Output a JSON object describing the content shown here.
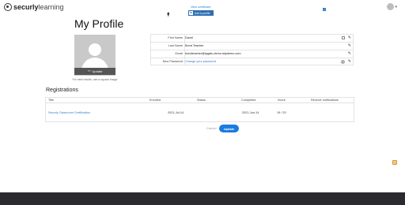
{
  "header": {
    "logo_bold": "securly",
    "logo_light": "learning",
    "account_caret": "▾"
  },
  "page": {
    "title": "My Profile"
  },
  "photo": {
    "update_label": "Update",
    "camera_icon": "📷",
    "hint": "For best results, use a square image"
  },
  "profile_fields": [
    {
      "label": "First Name",
      "value": "David"
    },
    {
      "label": "Last Name",
      "value": "Bond Teacher"
    },
    {
      "label": "Email",
      "value": "bondteacher@ipgatu.demo.lalpdemo.com"
    },
    {
      "label": "New Password",
      "value": "Change your password"
    }
  ],
  "registrations": {
    "title": "Registrations",
    "columns": [
      "Title",
      "Enrolled",
      "Status",
      "Completed",
      "Score",
      "Receive notifications"
    ],
    "rows": [
      {
        "title": "Securly Classroom Certification",
        "enrolled": "2021-Jul-14",
        "status_link": "View certificate",
        "linkedin_label": "Add to profile",
        "completed": "2021-Jun-14",
        "score": "19 / 20",
        "notifications": true
      }
    ]
  },
  "actions": {
    "cancel_label": "Cancel",
    "update_label": "Update"
  },
  "icons": {
    "edit": "✎",
    "linkedin": "in",
    "check": "✓",
    "info": "i"
  },
  "colors": {
    "accent": "#1a7be0",
    "link": "#2f7bd6",
    "footer": "#2b2b2f",
    "linkedin": "#2f6fb3"
  }
}
